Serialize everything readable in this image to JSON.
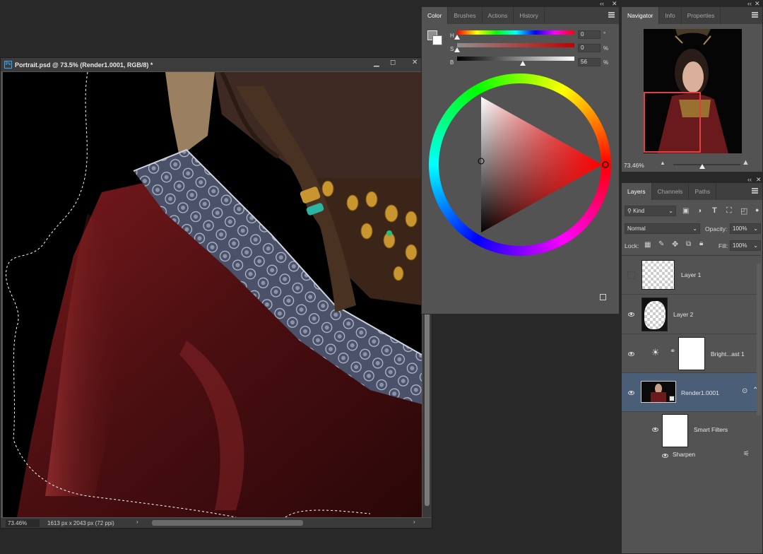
{
  "document": {
    "title": "Portrait.psd @ 73.5% (Render1.0001, RGB/8) *",
    "ps_badge": "Ps",
    "zoom": "73.46%",
    "dimensions": "1613 px x 2043 px (72 ppi)"
  },
  "color_panel": {
    "tabs": [
      "Color",
      "Brushes",
      "Actions",
      "History"
    ],
    "active_tab": "Color",
    "sliders": [
      {
        "label": "H",
        "value": "0",
        "unit": "°"
      },
      {
        "label": "S",
        "value": "0",
        "unit": "%"
      },
      {
        "label": "B",
        "value": "56",
        "unit": "%"
      }
    ],
    "hue_knob_fraction": 0.0,
    "sat_knob_fraction": 0.0,
    "bright_knob_fraction": 0.56,
    "foreground_color": "#8f8f8f",
    "background_color": "#ffffff"
  },
  "navigator_panel": {
    "tabs": [
      "Navigator",
      "Info",
      "Properties"
    ],
    "active_tab": "Navigator",
    "zoom": "73.46%"
  },
  "layers_panel": {
    "tabs": [
      "Layers",
      "Channels",
      "Paths"
    ],
    "active_tab": "Layers",
    "filter_kind": "Kind",
    "blend_mode": "Normal",
    "opacity_label": "Opacity:",
    "opacity": "100%",
    "lock_label": "Lock:",
    "fill_label": "Fill:",
    "fill": "100%",
    "layers": [
      {
        "name": "Layer 1",
        "visible": false
      },
      {
        "name": "Layer 2",
        "visible": true
      },
      {
        "name": "Bright...ast 1",
        "visible": true
      },
      {
        "name": "Render1.0001",
        "visible": true,
        "selected": true
      },
      {
        "name": "Smart Filters",
        "visible": true
      },
      {
        "name": "Sharpen",
        "visible": true
      }
    ]
  },
  "colors": {
    "accent_selection": "#4a5e78",
    "nav_view_rect": "#e53e3e"
  }
}
